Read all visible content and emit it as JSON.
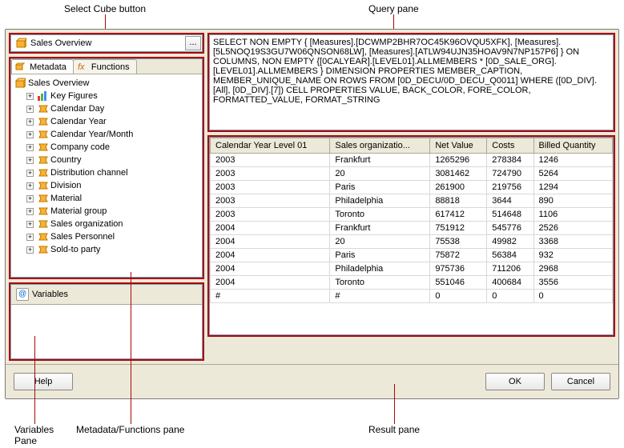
{
  "annotations": {
    "select_cube": "Select Cube button",
    "query_pane": "Query pane",
    "variables_pane": "Variables\nPane",
    "metadata_pane": "Metadata/Functions pane",
    "result_pane": "Result pane"
  },
  "cube_selector": {
    "text": "Sales Overview",
    "browse": "..."
  },
  "tabs": {
    "metadata": "Metadata",
    "functions": "Functions"
  },
  "tree": {
    "root": "Sales Overview",
    "items": [
      {
        "label": "Key Figures",
        "icon": "keyfig"
      },
      {
        "label": "Calendar Day",
        "icon": "dim"
      },
      {
        "label": "Calendar Year",
        "icon": "dim"
      },
      {
        "label": "Calendar Year/Month",
        "icon": "dim"
      },
      {
        "label": "Company code",
        "icon": "dim"
      },
      {
        "label": "Country",
        "icon": "dim"
      },
      {
        "label": "Distribution channel",
        "icon": "dim"
      },
      {
        "label": "Division",
        "icon": "dim"
      },
      {
        "label": "Material",
        "icon": "dim"
      },
      {
        "label": "Material group",
        "icon": "dim"
      },
      {
        "label": "Sales organization",
        "icon": "dim"
      },
      {
        "label": "Sales Personnel",
        "icon": "dim"
      },
      {
        "label": "Sold-to party",
        "icon": "dim"
      }
    ]
  },
  "variables": {
    "title": "Variables"
  },
  "query": {
    "text": "SELECT NON EMPTY { [Measures].[DCWMP2BHR7OC45K96OVQU5XFK], [Measures].[5L5NOQ19S3GU7W06QNSON68LW], [Measures].[ATLW94UJN35HOAV9N7NP157P6] } ON COLUMNS, NON EMPTY {[0CALYEAR].[LEVEL01].ALLMEMBERS * [0D_SALE_ORG].[LEVEL01].ALLMEMBERS } DIMENSION PROPERTIES MEMBER_CAPTION, MEMBER_UNIQUE_NAME ON ROWS FROM [0D_DECU/0D_DECU_Q0011] WHERE ([0D_DIV].[All], [0D_DIV].[7]) CELL PROPERTIES VALUE, BACK_COLOR, FORE_COLOR, FORMATTED_VALUE, FORMAT_STRING"
  },
  "result": {
    "columns": [
      "Calendar Year Level 01",
      "Sales organizatio...",
      "Net Value",
      "Costs",
      "Billed Quantity"
    ],
    "rows": [
      [
        "2003",
        "Frankfurt",
        "1265296",
        "278384",
        "1246"
      ],
      [
        "2003",
        "20",
        "3081462",
        "724790",
        "5264"
      ],
      [
        "2003",
        "Paris",
        "261900",
        "219756",
        "1294"
      ],
      [
        "2003",
        "Philadelphia",
        "88818",
        "3644",
        "890"
      ],
      [
        "2003",
        "Toronto",
        "617412",
        "514648",
        "1106"
      ],
      [
        "2004",
        "Frankfurt",
        "751912",
        "545776",
        "2526"
      ],
      [
        "2004",
        "20",
        "75538",
        "49982",
        "3368"
      ],
      [
        "2004",
        "Paris",
        "75872",
        "56384",
        "932"
      ],
      [
        "2004",
        "Philadelphia",
        "975736",
        "711206",
        "2968"
      ],
      [
        "2004",
        "Toronto",
        "551046",
        "400684",
        "3556"
      ],
      [
        "#",
        "#",
        "0",
        "0",
        "0"
      ]
    ]
  },
  "buttons": {
    "help": "Help",
    "ok": "OK",
    "cancel": "Cancel"
  },
  "chart_data": {
    "type": "table",
    "title": "Query result",
    "columns": [
      "Calendar Year Level 01",
      "Sales organization",
      "Net Value",
      "Costs",
      "Billed Quantity"
    ],
    "rows": [
      {
        "year": "2003",
        "org": "Frankfurt",
        "net_value": 1265296,
        "costs": 278384,
        "billed_qty": 1246
      },
      {
        "year": "2003",
        "org": "20",
        "net_value": 3081462,
        "costs": 724790,
        "billed_qty": 5264
      },
      {
        "year": "2003",
        "org": "Paris",
        "net_value": 261900,
        "costs": 219756,
        "billed_qty": 1294
      },
      {
        "year": "2003",
        "org": "Philadelphia",
        "net_value": 88818,
        "costs": 3644,
        "billed_qty": 890
      },
      {
        "year": "2003",
        "org": "Toronto",
        "net_value": 617412,
        "costs": 514648,
        "billed_qty": 1106
      },
      {
        "year": "2004",
        "org": "Frankfurt",
        "net_value": 751912,
        "costs": 545776,
        "billed_qty": 2526
      },
      {
        "year": "2004",
        "org": "20",
        "net_value": 75538,
        "costs": 49982,
        "billed_qty": 3368
      },
      {
        "year": "2004",
        "org": "Paris",
        "net_value": 75872,
        "costs": 56384,
        "billed_qty": 932
      },
      {
        "year": "2004",
        "org": "Philadelphia",
        "net_value": 975736,
        "costs": 711206,
        "billed_qty": 2968
      },
      {
        "year": "2004",
        "org": "Toronto",
        "net_value": 551046,
        "costs": 400684,
        "billed_qty": 3556
      }
    ]
  }
}
